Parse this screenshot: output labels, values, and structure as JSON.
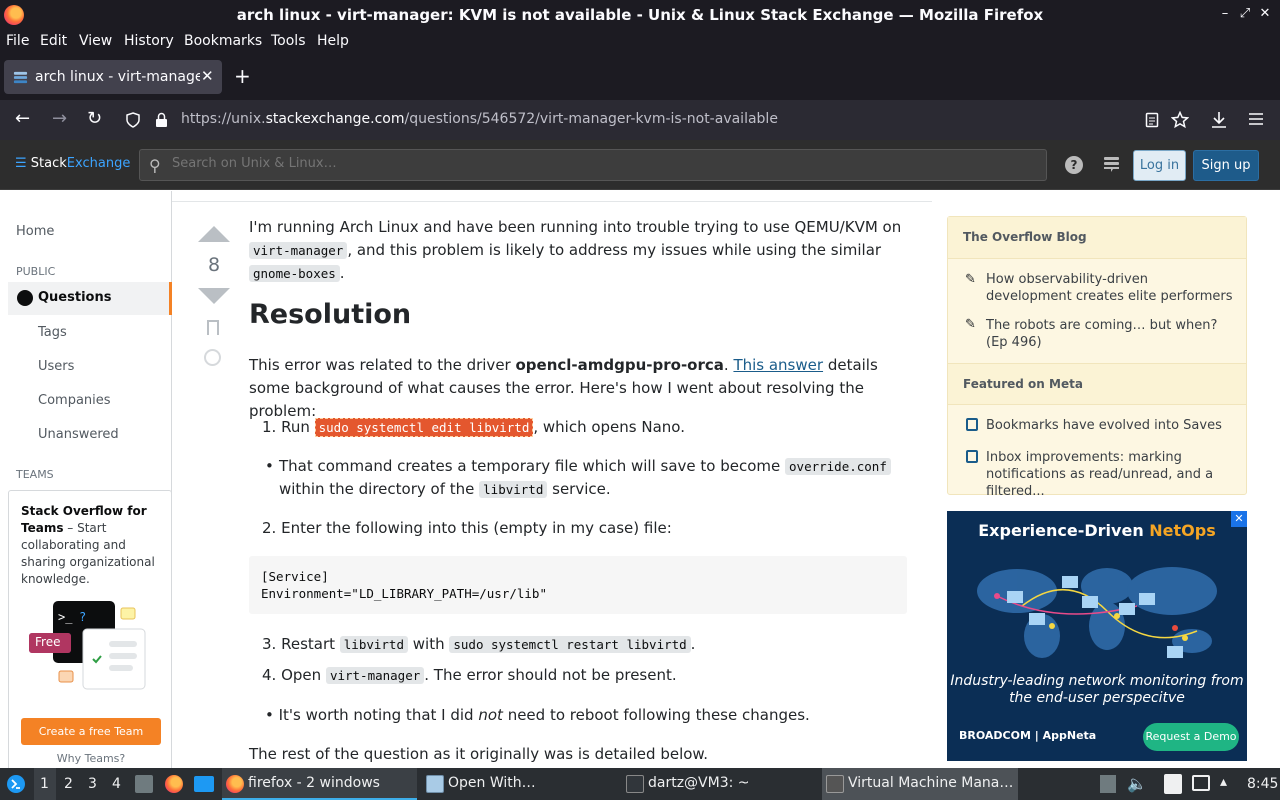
{
  "window": {
    "title": "arch linux - virt-manager: KVM is not available - Unix & Linux Stack Exchange — Mozilla Firefox",
    "controls": [
      "–",
      "⤢",
      "✕"
    ]
  },
  "menu": [
    "File",
    "Edit",
    "View",
    "History",
    "Bookmarks",
    "Tools",
    "Help"
  ],
  "tab": {
    "label": "arch linux - virt-manager",
    "close": "✕",
    "new": "+"
  },
  "url": {
    "prefix": "https://unix.",
    "domain": "stackexchange.com",
    "path": "/questions/546572/virt-manager-kvm-is-not-available"
  },
  "site_header": {
    "logo_a": "Stack",
    "logo_b": "Exchange",
    "search_placeholder": "Search on Unix & Linux…",
    "help": "?",
    "login": "Log in",
    "signup": "Sign up"
  },
  "left_nav": {
    "home": "Home",
    "public": "PUBLIC",
    "questions": "Questions",
    "tags": "Tags",
    "users": "Users",
    "companies": "Companies",
    "unanswered": "Unanswered",
    "teams": "TEAMS",
    "teams_title": "Stack Overflow for Teams",
    "teams_desc": " – Start collaborating and sharing organizational knowledge.",
    "free_badge": "Free",
    "create_team": "Create a free Team",
    "why_teams": "Why Teams?"
  },
  "vote": {
    "count": "8"
  },
  "post": {
    "intro_1": "I'm running Arch Linux and have been running into trouble trying to use QEMU/KVM on ",
    "intro_code1": "virt-manager",
    "intro_2": ", and this problem is likely to address my issues while using the similar ",
    "intro_code2": "gnome-boxes",
    "intro_3": ".",
    "heading": "Resolution",
    "res_1": "This error was related to the driver ",
    "res_bold": "opencl-amdgpu-pro-orca",
    "res_2": ". ",
    "res_link": "This answer",
    "res_3": " details some background of what causes the error. Here's how I went about resolving the problem:",
    "step1_a": "Run ",
    "step1_code": "sudo systemctl edit libvirtd",
    "step1_b": ", which opens Nano.",
    "bullet1_a": "That command creates a temporary file which will save to become ",
    "bullet1_code1": "override.conf",
    "bullet1_b": " within the directory of the ",
    "bullet1_code2": "libvirtd",
    "bullet1_c": " service.",
    "step2": "Enter the following into this (empty in my case) file:",
    "codeblock": "[Service]\nEnvironment=\"LD_LIBRARY_PATH=/usr/lib\"",
    "step3_a": "Restart ",
    "step3_code1": "libvirtd",
    "step3_b": " with ",
    "step3_code2": "sudo systemctl restart libvirtd",
    "step3_c": ".",
    "step4_a": "Open ",
    "step4_code": "virt-manager",
    "step4_b": ". The error should not be present.",
    "bullet2_a": "It's worth noting that I did ",
    "bullet2_em": "not",
    "bullet2_b": " need to reboot following these changes.",
    "rest": "The rest of the question as it originally was is detailed below."
  },
  "blog": {
    "title": "The Overflow Blog",
    "items": [
      "How observability-driven development creates elite performers",
      "The robots are coming… but when? (Ep 496)"
    ],
    "meta_title": "Featured on Meta",
    "meta_items": [
      "Bookmarks have evolved into Saves",
      "Inbox improvements: marking notifications as read/unread, and a filtered..."
    ]
  },
  "ad": {
    "title_a": "Experience-Driven ",
    "title_b": "NetOps",
    "sub": "Industry-leading network monitoring from the end-user perspecitve",
    "brand": "BROADCOM | AppNeta",
    "cta": "Request a Demo",
    "close": "✕"
  },
  "taskbar": {
    "workspaces": [
      "1",
      "2",
      "3",
      "4"
    ],
    "tasks": [
      "firefox - 2 windows",
      "Open With…",
      "dartz@VM3: ~",
      "Virtual Machine Mana…"
    ],
    "clock": "8:45"
  },
  "colors": {
    "accent": "#f48225",
    "link": "#1a5c8a",
    "highlight": "#e4572e",
    "firefox_bg": "#1c1b22"
  }
}
